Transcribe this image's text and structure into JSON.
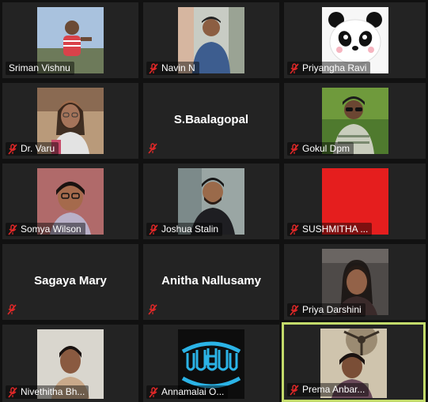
{
  "colors": {
    "tile_bg": "#232323",
    "active_border": "#c3db6b",
    "mute_red": "#e02828",
    "background": "#111111"
  },
  "participants": [
    {
      "name": "Sriman Vishnu",
      "muted": false,
      "video": "photo-man-red-shirt"
    },
    {
      "name": "Navin N",
      "muted": true,
      "video": "photo-man-blue-shirt"
    },
    {
      "name": "Priyangha Ravi",
      "muted": true,
      "video": "panda-avatar"
    },
    {
      "name": "Dr. Varu",
      "muted": true,
      "video": "photo-woman-glasses"
    },
    {
      "name": "S.Baalagopal",
      "muted": true,
      "video": "none"
    },
    {
      "name": "Gokul Dpm",
      "muted": true,
      "video": "photo-man-sunglasses"
    },
    {
      "name": "Somya Wilson",
      "muted": true,
      "video": "photo-woman-glasses"
    },
    {
      "name": "Joshua Stalin",
      "muted": true,
      "video": "photo-man-beard"
    },
    {
      "name": "SUSHMITHA ...",
      "muted": true,
      "video": "red-screen"
    },
    {
      "name": "Sagaya Mary",
      "muted": true,
      "video": "none"
    },
    {
      "name": "Anitha Nallusamy",
      "muted": true,
      "video": "none"
    },
    {
      "name": "Priya Darshini",
      "muted": true,
      "video": "photo-woman"
    },
    {
      "name": "Nivethitha Bh...",
      "muted": true,
      "video": "photo-woman"
    },
    {
      "name": "Annamalai O...",
      "muted": true,
      "video": "teeth-logo"
    },
    {
      "name": "Prema Anbar...",
      "muted": true,
      "video": "photo-woman-ceiling-fan",
      "active_speaker": true
    }
  ]
}
